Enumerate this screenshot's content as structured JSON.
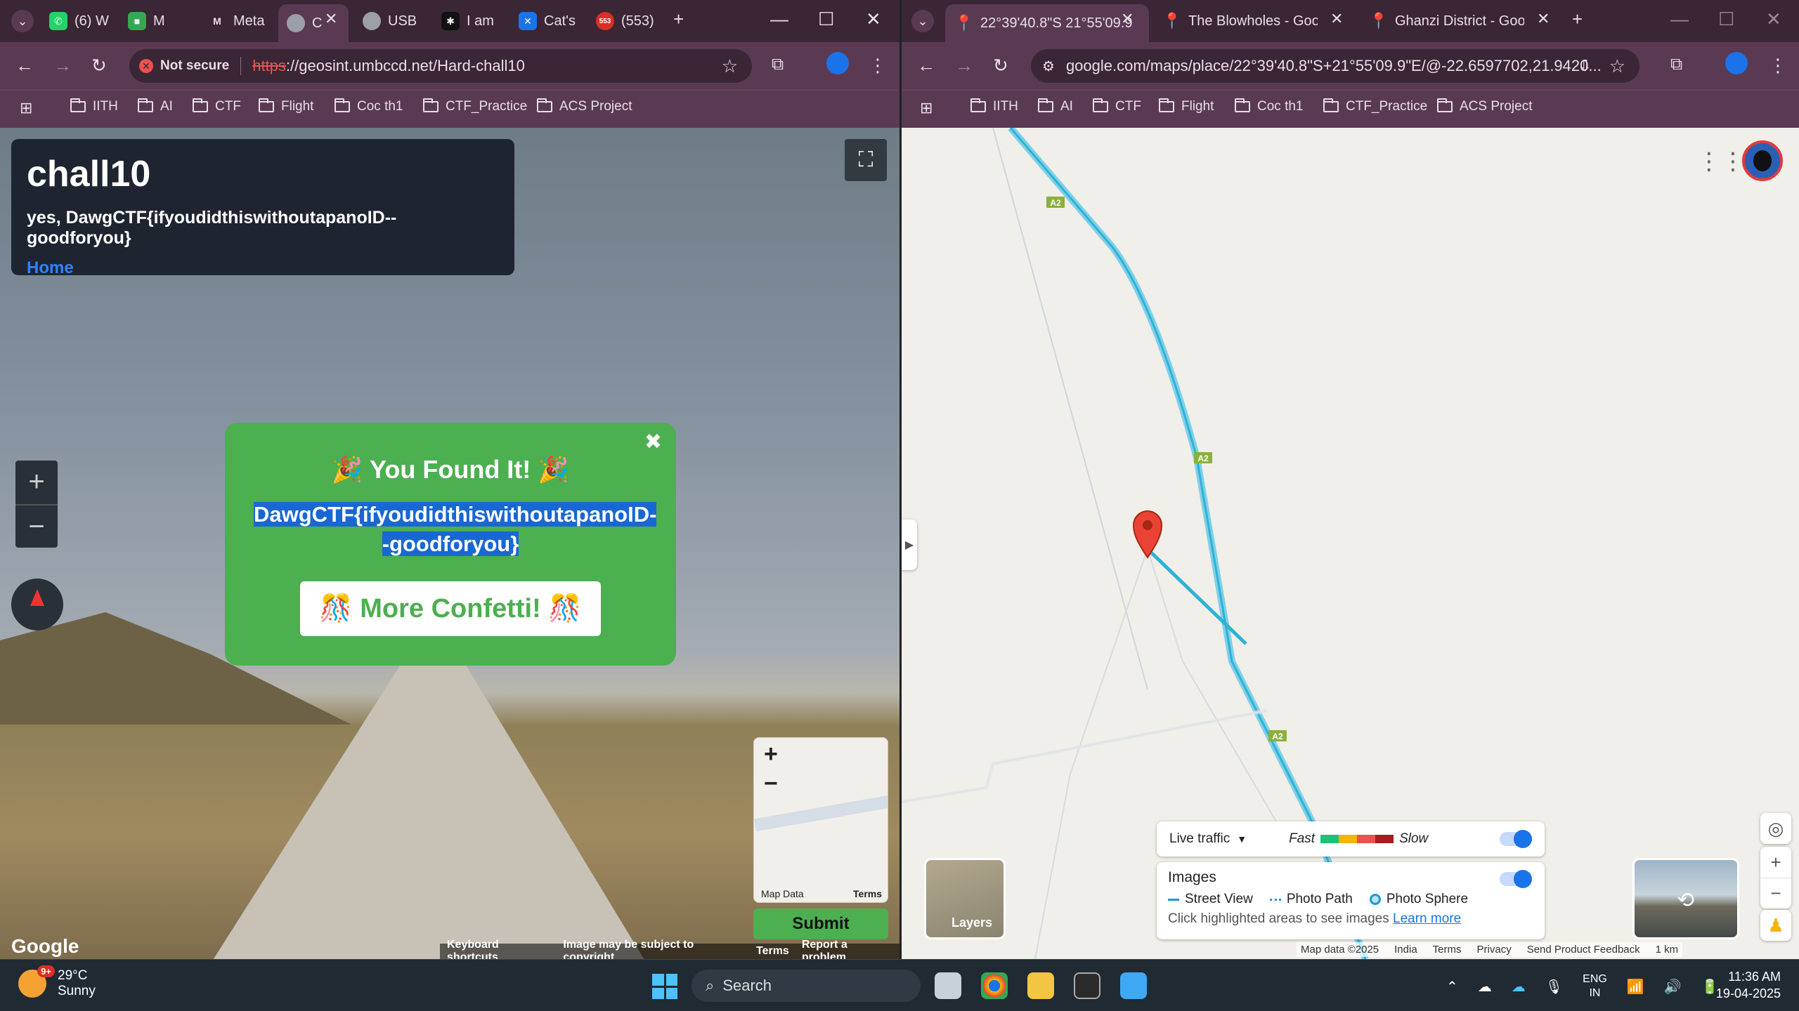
{
  "left_window": {
    "tabs": [
      {
        "label": "(6) W",
        "icon": "whatsapp-icon",
        "color": "#25d366"
      },
      {
        "label": "M",
        "icon": "meet-icon",
        "color": "#34a853"
      },
      {
        "label": "Meta",
        "icon": "medium-icon",
        "color": "#9aa0a6"
      },
      {
        "label": "C",
        "icon": "globe-icon",
        "color": "#9aa0a6"
      },
      {
        "label": "USB",
        "icon": "chatgpt-icon",
        "color": "#9aa0a6"
      },
      {
        "label": "I am",
        "icon": "app-icon",
        "color": "#111"
      },
      {
        "label": "Cat's",
        "icon": "butterfly-icon",
        "color": "#1a73e8"
      },
      {
        "label": "(553)",
        "icon": "mail-icon",
        "color": "#d93025"
      }
    ],
    "address": {
      "security": "Not secure",
      "url_scheme": "https",
      "url_rest": "://geosint.umbccd.net/Hard-chall10"
    },
    "bookmarks": [
      "IITH",
      "AI",
      "CTF",
      "Flight",
      "Coc th1",
      "CTF_Practice",
      "ACS Project"
    ],
    "challenge": {
      "title": "chall10",
      "flag_line": "yes, DawgCTF{ifyoudidthiswithoutapanoID--goodforyou}",
      "home": "Home"
    },
    "popup": {
      "title": "🎉 You Found It! 🎉",
      "flag": "DawgCTF{ifyoudidthiswithoutapanoID--goodforyou}",
      "confetti": "🎊 More Confetti! 🎊",
      "close": "✖"
    },
    "minimap": {
      "zoom_in": "+",
      "zoom_out": "−",
      "credit": "Map Data",
      "terms": "Terms"
    },
    "submit": "Submit",
    "google": "Google",
    "footer": [
      "Keyboard shortcuts",
      "Image may be subject to copyright",
      "Terms",
      "Report a problem"
    ]
  },
  "right_window": {
    "tabs": [
      {
        "label": "22°39'40.8\"S 21°55'09.9",
        "icon": "maps-pin-icon"
      },
      {
        "label": "The Blowholes - Google",
        "icon": "maps-pin-icon"
      },
      {
        "label": "Ghanzi District - Google",
        "icon": "maps-pin-icon"
      }
    ],
    "address": {
      "url": "google.com/maps/place/22°39'40.8\"S+21°55'09.9\"E/@-22.6597702,21.9420..."
    },
    "bookmarks": [
      "IITH",
      "AI",
      "CTF",
      "Flight",
      "Coc th1",
      "CTF_Practice",
      "ACS Project"
    ],
    "road_labels": [
      "A2",
      "A2",
      "A2"
    ],
    "traffic": {
      "label": "Live traffic",
      "fast": "Fast",
      "slow": "Slow",
      "colors": [
        "#1ec07a",
        "#f4b400",
        "#e8534d",
        "#a61d1d"
      ]
    },
    "images": {
      "title": "Images",
      "street_view": "Street View",
      "photo_path": "Photo Path",
      "photo_sphere": "Photo Sphere",
      "hint": "Click highlighted areas to see images",
      "learn_more": "Learn more"
    },
    "layers": "Layers",
    "footer": [
      "Map data ©2025",
      "India",
      "Terms",
      "Privacy",
      "Send Product Feedback",
      "1 km"
    ]
  },
  "taskbar": {
    "weather_temp": "29°C",
    "weather_desc": "Sunny",
    "weather_badge": "9+",
    "search": "Search",
    "lang_top": "ENG",
    "lang_bottom": "IN",
    "time": "11:36 AM",
    "date": "19-04-2025"
  }
}
